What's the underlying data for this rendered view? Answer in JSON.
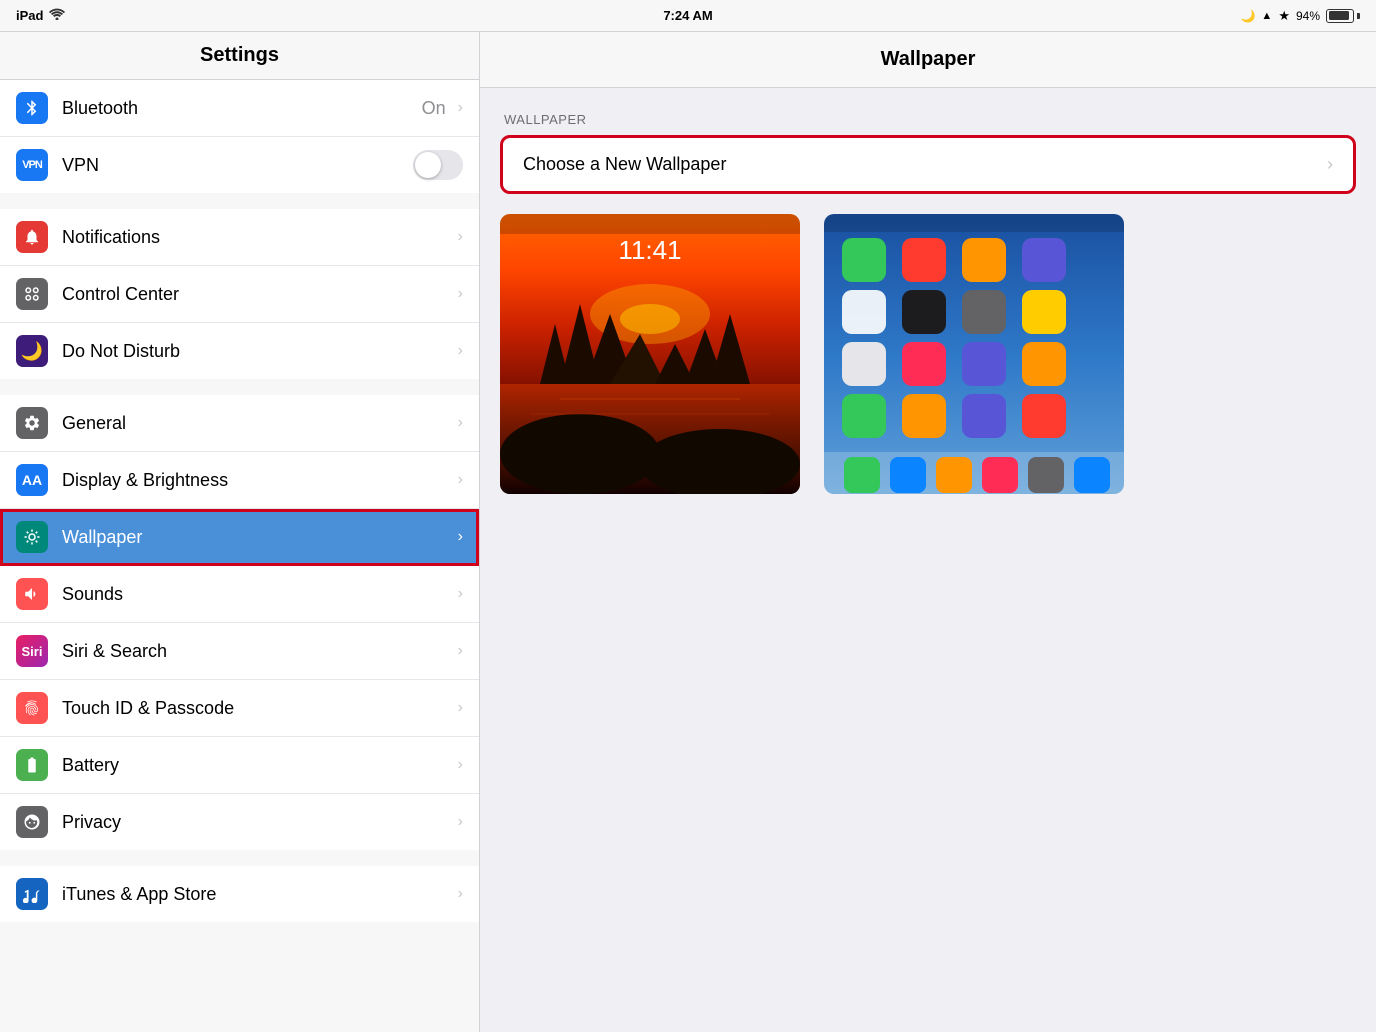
{
  "statusBar": {
    "device": "iPad",
    "wifi": "wifi",
    "time": "7:24 AM",
    "moon": "🌙",
    "location": "◂",
    "bluetooth": "bluetooth",
    "battery_percent": "94%"
  },
  "sidebar": {
    "title": "Settings",
    "groups": [
      {
        "id": "connectivity",
        "items": [
          {
            "id": "bluetooth",
            "label": "Bluetooth",
            "iconBg": "bg-blue",
            "icon": "bluetooth",
            "value": "On",
            "hasChevron": false,
            "hasToggle": false,
            "hasValue": true
          },
          {
            "id": "vpn",
            "label": "VPN",
            "iconBg": "bg-blue",
            "icon": "vpn",
            "hasToggle": true,
            "hasChevron": false
          }
        ]
      },
      {
        "id": "system",
        "items": [
          {
            "id": "notifications",
            "label": "Notifications",
            "iconBg": "bg-red",
            "icon": "notifications",
            "hasChevron": true
          },
          {
            "id": "control-center",
            "label": "Control Center",
            "iconBg": "bg-gray",
            "icon": "control-center",
            "hasChevron": true
          },
          {
            "id": "do-not-disturb",
            "label": "Do Not Disturb",
            "iconBg": "bg-dark-purple",
            "icon": "moon",
            "hasChevron": true
          }
        ]
      },
      {
        "id": "personalization",
        "items": [
          {
            "id": "general",
            "label": "General",
            "iconBg": "bg-gray",
            "icon": "gear",
            "hasChevron": true
          },
          {
            "id": "display",
            "label": "Display & Brightness",
            "iconBg": "bg-blue",
            "icon": "display",
            "hasChevron": true
          },
          {
            "id": "wallpaper",
            "label": "Wallpaper",
            "iconBg": "bg-teal",
            "icon": "wallpaper",
            "hasChevron": true,
            "active": true
          },
          {
            "id": "sounds",
            "label": "Sounds",
            "iconBg": "bg-coral",
            "icon": "sounds",
            "hasChevron": true
          },
          {
            "id": "siri",
            "label": "Siri & Search",
            "iconBg": "bg-multicolor",
            "icon": "siri",
            "hasChevron": true
          },
          {
            "id": "touch-id",
            "label": "Touch ID & Passcode",
            "iconBg": "bg-coral",
            "icon": "touch-id",
            "hasChevron": true
          },
          {
            "id": "battery",
            "label": "Battery",
            "iconBg": "bg-green",
            "icon": "battery",
            "hasChevron": true
          },
          {
            "id": "privacy",
            "label": "Privacy",
            "iconBg": "bg-gray",
            "icon": "privacy",
            "hasChevron": true
          }
        ]
      },
      {
        "id": "store",
        "items": [
          {
            "id": "itunes",
            "label": "iTunes & App Store",
            "iconBg": "bg-blue2",
            "icon": "appstore",
            "hasChevron": true
          }
        ]
      }
    ]
  },
  "content": {
    "title": "Wallpaper",
    "sectionLabel": "WALLPAPER",
    "chooseLabel": "Choose a New Wallpaper",
    "lockScreenPreviewTime": "11:41"
  }
}
